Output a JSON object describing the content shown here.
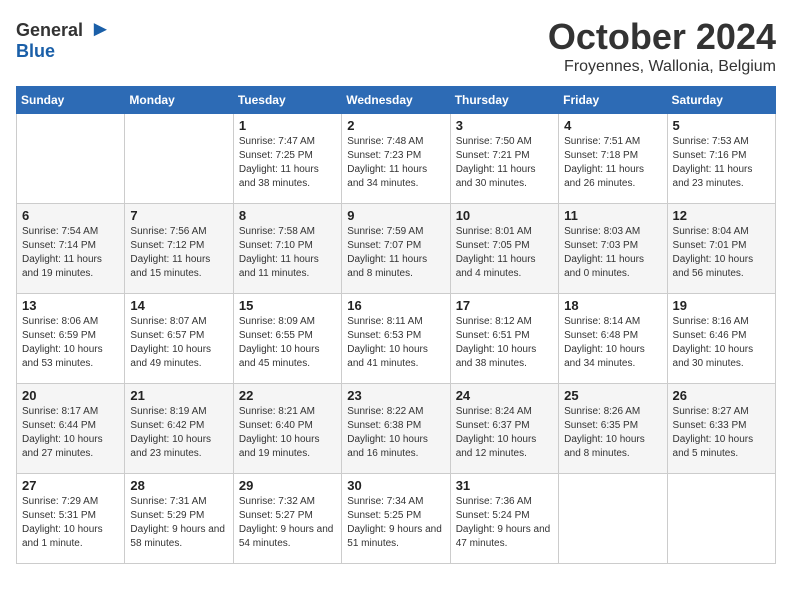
{
  "header": {
    "logo": {
      "general": "General",
      "blue": "Blue"
    },
    "month": "October 2024",
    "location": "Froyennes, Wallonia, Belgium"
  },
  "weekdays": [
    "Sunday",
    "Monday",
    "Tuesday",
    "Wednesday",
    "Thursday",
    "Friday",
    "Saturday"
  ],
  "weeks": [
    [
      {
        "day": "",
        "info": ""
      },
      {
        "day": "",
        "info": ""
      },
      {
        "day": "1",
        "info": "Sunrise: 7:47 AM\nSunset: 7:25 PM\nDaylight: 11 hours and 38 minutes."
      },
      {
        "day": "2",
        "info": "Sunrise: 7:48 AM\nSunset: 7:23 PM\nDaylight: 11 hours and 34 minutes."
      },
      {
        "day": "3",
        "info": "Sunrise: 7:50 AM\nSunset: 7:21 PM\nDaylight: 11 hours and 30 minutes."
      },
      {
        "day": "4",
        "info": "Sunrise: 7:51 AM\nSunset: 7:18 PM\nDaylight: 11 hours and 26 minutes."
      },
      {
        "day": "5",
        "info": "Sunrise: 7:53 AM\nSunset: 7:16 PM\nDaylight: 11 hours and 23 minutes."
      }
    ],
    [
      {
        "day": "6",
        "info": "Sunrise: 7:54 AM\nSunset: 7:14 PM\nDaylight: 11 hours and 19 minutes."
      },
      {
        "day": "7",
        "info": "Sunrise: 7:56 AM\nSunset: 7:12 PM\nDaylight: 11 hours and 15 minutes."
      },
      {
        "day": "8",
        "info": "Sunrise: 7:58 AM\nSunset: 7:10 PM\nDaylight: 11 hours and 11 minutes."
      },
      {
        "day": "9",
        "info": "Sunrise: 7:59 AM\nSunset: 7:07 PM\nDaylight: 11 hours and 8 minutes."
      },
      {
        "day": "10",
        "info": "Sunrise: 8:01 AM\nSunset: 7:05 PM\nDaylight: 11 hours and 4 minutes."
      },
      {
        "day": "11",
        "info": "Sunrise: 8:03 AM\nSunset: 7:03 PM\nDaylight: 11 hours and 0 minutes."
      },
      {
        "day": "12",
        "info": "Sunrise: 8:04 AM\nSunset: 7:01 PM\nDaylight: 10 hours and 56 minutes."
      }
    ],
    [
      {
        "day": "13",
        "info": "Sunrise: 8:06 AM\nSunset: 6:59 PM\nDaylight: 10 hours and 53 minutes."
      },
      {
        "day": "14",
        "info": "Sunrise: 8:07 AM\nSunset: 6:57 PM\nDaylight: 10 hours and 49 minutes."
      },
      {
        "day": "15",
        "info": "Sunrise: 8:09 AM\nSunset: 6:55 PM\nDaylight: 10 hours and 45 minutes."
      },
      {
        "day": "16",
        "info": "Sunrise: 8:11 AM\nSunset: 6:53 PM\nDaylight: 10 hours and 41 minutes."
      },
      {
        "day": "17",
        "info": "Sunrise: 8:12 AM\nSunset: 6:51 PM\nDaylight: 10 hours and 38 minutes."
      },
      {
        "day": "18",
        "info": "Sunrise: 8:14 AM\nSunset: 6:48 PM\nDaylight: 10 hours and 34 minutes."
      },
      {
        "day": "19",
        "info": "Sunrise: 8:16 AM\nSunset: 6:46 PM\nDaylight: 10 hours and 30 minutes."
      }
    ],
    [
      {
        "day": "20",
        "info": "Sunrise: 8:17 AM\nSunset: 6:44 PM\nDaylight: 10 hours and 27 minutes."
      },
      {
        "day": "21",
        "info": "Sunrise: 8:19 AM\nSunset: 6:42 PM\nDaylight: 10 hours and 23 minutes."
      },
      {
        "day": "22",
        "info": "Sunrise: 8:21 AM\nSunset: 6:40 PM\nDaylight: 10 hours and 19 minutes."
      },
      {
        "day": "23",
        "info": "Sunrise: 8:22 AM\nSunset: 6:38 PM\nDaylight: 10 hours and 16 minutes."
      },
      {
        "day": "24",
        "info": "Sunrise: 8:24 AM\nSunset: 6:37 PM\nDaylight: 10 hours and 12 minutes."
      },
      {
        "day": "25",
        "info": "Sunrise: 8:26 AM\nSunset: 6:35 PM\nDaylight: 10 hours and 8 minutes."
      },
      {
        "day": "26",
        "info": "Sunrise: 8:27 AM\nSunset: 6:33 PM\nDaylight: 10 hours and 5 minutes."
      }
    ],
    [
      {
        "day": "27",
        "info": "Sunrise: 7:29 AM\nSunset: 5:31 PM\nDaylight: 10 hours and 1 minute."
      },
      {
        "day": "28",
        "info": "Sunrise: 7:31 AM\nSunset: 5:29 PM\nDaylight: 9 hours and 58 minutes."
      },
      {
        "day": "29",
        "info": "Sunrise: 7:32 AM\nSunset: 5:27 PM\nDaylight: 9 hours and 54 minutes."
      },
      {
        "day": "30",
        "info": "Sunrise: 7:34 AM\nSunset: 5:25 PM\nDaylight: 9 hours and 51 minutes."
      },
      {
        "day": "31",
        "info": "Sunrise: 7:36 AM\nSunset: 5:24 PM\nDaylight: 9 hours and 47 minutes."
      },
      {
        "day": "",
        "info": ""
      },
      {
        "day": "",
        "info": ""
      }
    ]
  ]
}
